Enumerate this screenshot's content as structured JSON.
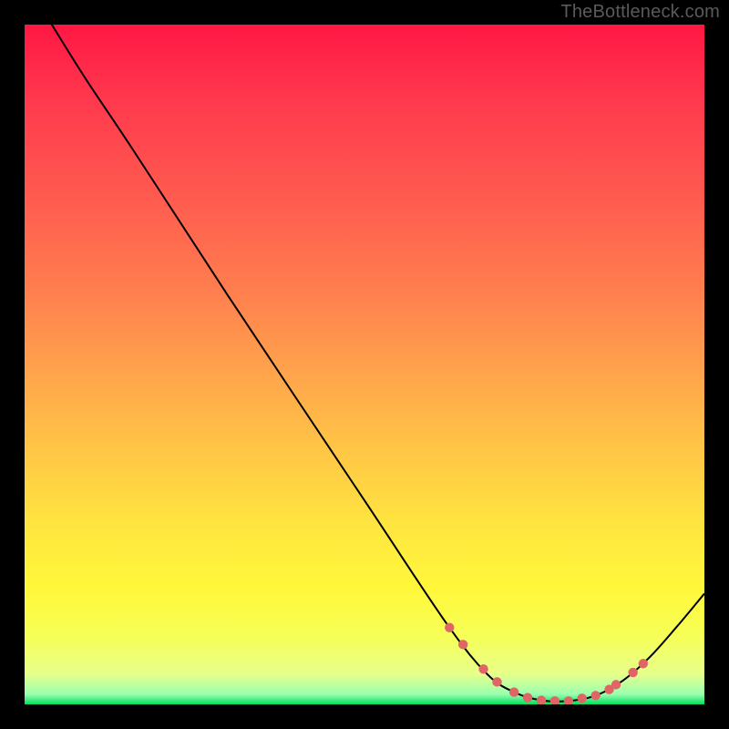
{
  "watermark": "TheBottleneck.com",
  "chart_data": {
    "type": "line",
    "title": "",
    "xlabel": "",
    "ylabel": "",
    "xlim": [
      0,
      100
    ],
    "ylim": [
      0,
      100
    ],
    "grid": false,
    "legend": false,
    "series": [
      {
        "name": "curve",
        "points": [
          {
            "x": 4,
            "y": 100
          },
          {
            "x": 9,
            "y": 92
          },
          {
            "x": 16,
            "y": 81.5
          },
          {
            "x": 30,
            "y": 60
          },
          {
            "x": 50,
            "y": 30
          },
          {
            "x": 62,
            "y": 12
          },
          {
            "x": 68,
            "y": 4.5
          },
          {
            "x": 72,
            "y": 1.8
          },
          {
            "x": 76,
            "y": 0.6
          },
          {
            "x": 80,
            "y": 0.5
          },
          {
            "x": 84,
            "y": 1.3
          },
          {
            "x": 88,
            "y": 3.5
          },
          {
            "x": 92,
            "y": 7
          },
          {
            "x": 96,
            "y": 11.5
          },
          {
            "x": 100,
            "y": 16.3
          }
        ]
      },
      {
        "name": "dotted-segment",
        "points": [
          {
            "x": 62.5,
            "y": 11.3
          },
          {
            "x": 64.5,
            "y": 8.8
          },
          {
            "x": 67.5,
            "y": 5.2
          },
          {
            "x": 69.5,
            "y": 3.3
          },
          {
            "x": 72.0,
            "y": 1.8
          },
          {
            "x": 74.0,
            "y": 1.0
          },
          {
            "x": 76.0,
            "y": 0.6
          },
          {
            "x": 78.0,
            "y": 0.5
          },
          {
            "x": 80.0,
            "y": 0.5
          },
          {
            "x": 82.0,
            "y": 0.9
          },
          {
            "x": 84.0,
            "y": 1.3
          },
          {
            "x": 86.0,
            "y": 2.2
          },
          {
            "x": 87.0,
            "y": 2.9
          },
          {
            "x": 89.5,
            "y": 4.7
          },
          {
            "x": 91.0,
            "y": 6.0
          }
        ]
      }
    ],
    "gradient_stops": [
      {
        "offset": 0.0,
        "color": "#ff1744"
      },
      {
        "offset": 0.12,
        "color": "#ff3b4e"
      },
      {
        "offset": 0.25,
        "color": "#ff5a4f"
      },
      {
        "offset": 0.38,
        "color": "#ff7b4f"
      },
      {
        "offset": 0.5,
        "color": "#ffa04c"
      },
      {
        "offset": 0.62,
        "color": "#ffc446"
      },
      {
        "offset": 0.74,
        "color": "#ffe63f"
      },
      {
        "offset": 0.83,
        "color": "#fff83a"
      },
      {
        "offset": 0.9,
        "color": "#f6ff57"
      },
      {
        "offset": 0.955,
        "color": "#e7ff8a"
      },
      {
        "offset": 0.985,
        "color": "#9bffb0"
      },
      {
        "offset": 1.0,
        "color": "#00e05e"
      }
    ],
    "curve_color": "#000000",
    "dot_color": "#e06666",
    "dot_radius": 5.2
  }
}
